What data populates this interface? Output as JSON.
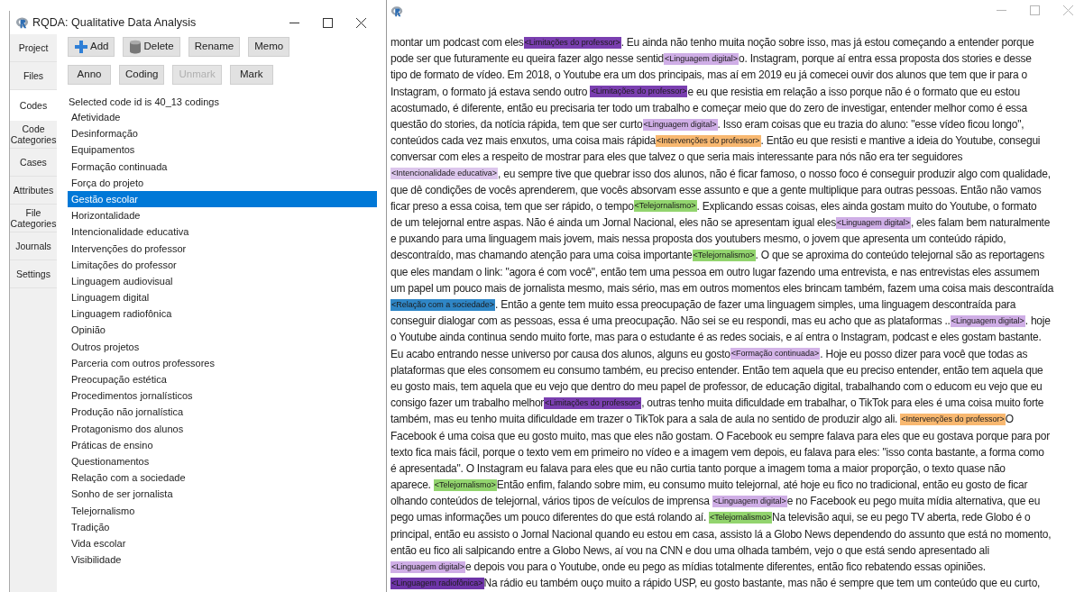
{
  "left_window": {
    "title": "RQDA: Qualitative Data Analysis",
    "sidebar_tabs": [
      {
        "label": "Project",
        "selected": false
      },
      {
        "label": "Files",
        "selected": false
      },
      {
        "label": "Codes",
        "selected": true
      },
      {
        "label": "Code Categories",
        "selected": false
      },
      {
        "label": "Cases",
        "selected": false
      },
      {
        "label": "Attributes",
        "selected": false
      },
      {
        "label": "File Categories",
        "selected": false
      },
      {
        "label": "Journals",
        "selected": false
      },
      {
        "label": "Settings",
        "selected": false
      }
    ],
    "button_rows": [
      [
        {
          "kind": "add",
          "label": "Add",
          "disabled": false
        },
        {
          "kind": "delete",
          "label": "Delete",
          "disabled": false
        },
        {
          "kind": "plain",
          "label": "Rename",
          "disabled": false
        },
        {
          "kind": "plain",
          "label": "Memo",
          "disabled": false
        }
      ],
      [
        {
          "kind": "plain",
          "label": "Anno",
          "disabled": false
        },
        {
          "kind": "plain",
          "label": "Coding",
          "disabled": false
        },
        {
          "kind": "plain",
          "label": "Unmark",
          "disabled": true
        },
        {
          "kind": "plain",
          "label": "Mark",
          "disabled": false
        }
      ]
    ],
    "status": "Selected code id is 40_13 codings",
    "codes": [
      {
        "label": "Afetividade",
        "selected": false
      },
      {
        "label": "Desinformação",
        "selected": false
      },
      {
        "label": "Equipamentos",
        "selected": false
      },
      {
        "label": "Formação continuada",
        "selected": false
      },
      {
        "label": "Força do projeto",
        "selected": false
      },
      {
        "label": "Gestão escolar",
        "selected": true
      },
      {
        "label": "Horizontalidade",
        "selected": false
      },
      {
        "label": "Intencionalidade educativa",
        "selected": false
      },
      {
        "label": "Intervenções do professor",
        "selected": false
      },
      {
        "label": "Limitações do professor",
        "selected": false
      },
      {
        "label": "Linguagem audiovisual",
        "selected": false
      },
      {
        "label": "Linguagem digital",
        "selected": false
      },
      {
        "label": "Linguagem radiofônica",
        "selected": false
      },
      {
        "label": "Opinião",
        "selected": false
      },
      {
        "label": "Outros projetos",
        "selected": false
      },
      {
        "label": "Parceria com outros professores",
        "selected": false
      },
      {
        "label": "Preocupação estética",
        "selected": false
      },
      {
        "label": "Procedimentos jornalísticos",
        "selected": false
      },
      {
        "label": "Produção não jornalística",
        "selected": false
      },
      {
        "label": "Protagonismo dos alunos",
        "selected": false
      },
      {
        "label": "Práticas de ensino",
        "selected": false
      },
      {
        "label": "Questionamentos",
        "selected": false
      },
      {
        "label": "Relação com a sociedade",
        "selected": false
      },
      {
        "label": "Sonho de ser jornalista",
        "selected": false
      },
      {
        "label": "Telejornalismo",
        "selected": false
      },
      {
        "label": "Tradição",
        "selected": false
      },
      {
        "label": "Vida escolar",
        "selected": false
      },
      {
        "label": "Visibilidade",
        "selected": false
      }
    ]
  },
  "right_window": {
    "lines": [
      {
        "segments": [
          {
            "kind": "text",
            "text": "montar um podcast com eles"
          },
          {
            "kind": "code",
            "text": "<Limitações do professor>",
            "color": "#7a3fb0"
          },
          {
            "kind": "text",
            "text": ". Eu ainda não tenho muita noção sobre isso, mas já estou começando a entender porque"
          }
        ]
      },
      {
        "segments": [
          {
            "kind": "text",
            "text": "pode ser que futuramente eu queira fazer algo nesse sentid"
          },
          {
            "kind": "code",
            "text": "<Linguagem digital>",
            "color": "#cfaee6"
          },
          {
            "kind": "text",
            "text": "o. Instagram, porque aí entra essa proposta dos stories e desse"
          }
        ]
      },
      {
        "segments": [
          {
            "kind": "text",
            "text": "tipo de formato de vídeo. Em 2018, o Youtube era um dos principais, mas aí em 2019 eu já comecei ouvir dos alunos que tem que ir para o"
          }
        ]
      },
      {
        "segments": [
          {
            "kind": "text",
            "text": "Instagram, o formato já estava sendo outro "
          },
          {
            "kind": "code",
            "text": "<Limitações do professor>",
            "color": "#7a3fb0"
          },
          {
            "kind": "text",
            "text": "e eu que resistia em relação a isso porque não é o formato que eu estou"
          }
        ]
      },
      {
        "segments": [
          {
            "kind": "text",
            "text": "acostumado, é diferente, então eu precisaria ter todo um trabalho e começar meio que do zero de investigar, entender melhor como é essa"
          }
        ]
      },
      {
        "segments": [
          {
            "kind": "text",
            "text": "questão do stories, da notícia rápida, tem que ser curto"
          },
          {
            "kind": "code",
            "text": "<Linguagem digital>",
            "color": "#cfaee6"
          },
          {
            "kind": "text",
            "text": ". Isso eram coisas que eu trazia do aluno: \"esse vídeo ficou longo\","
          }
        ]
      },
      {
        "segments": [
          {
            "kind": "text",
            "text": "conteúdos cada vez mais enxutos, uma coisa mais rápida"
          },
          {
            "kind": "code",
            "text": "<Intervenções do professor>",
            "color": "#f8b870"
          },
          {
            "kind": "text",
            "text": ". Então eu que resisti e mantive a ideia do Youtube, consegui"
          }
        ]
      },
      {
        "segments": [
          {
            "kind": "text",
            "text": "conversar com eles a respeito de mostrar para eles que talvez o que seria mais interessante para nós não era ter seguidores"
          }
        ]
      },
      {
        "segments": [
          {
            "kind": "code",
            "text": "<Intencionalidade educativa>",
            "color": "#dcc6ec"
          },
          {
            "kind": "text",
            "text": ", eu sempre tive que quebrar isso dos alunos, não é ficar famoso, o nosso foco é conseguir produzir algo com qualidade,"
          }
        ]
      },
      {
        "segments": [
          {
            "kind": "text",
            "text": "que dê condições de vocês aprenderem, que vocês absorvam esse assunto e que a gente multiplique para outras pessoas. Então não vamos"
          }
        ]
      },
      {
        "segments": [
          {
            "kind": "text",
            "text": "ficar preso a essa coisa, tem que ser rápido, o tempo"
          },
          {
            "kind": "code",
            "text": "<Telejornalismo>",
            "color": "#92d46e"
          },
          {
            "kind": "text",
            "text": ". Explicando essas coisas, eles ainda gostam muito do Youtube, o formato"
          }
        ]
      },
      {
        "segments": [
          {
            "kind": "text",
            "text": "de um telejornal entre aspas. Não é ainda um Jornal Nacional, eles não se apresentam igual eles"
          },
          {
            "kind": "code",
            "text": "<Linguagem digital>",
            "color": "#cfaee6"
          },
          {
            "kind": "text",
            "text": ", eles falam bem naturalmente"
          }
        ]
      },
      {
        "segments": [
          {
            "kind": "text",
            "text": "e puxando para uma linguagem mais jovem, mais nessa proposta dos youtubers mesmo, o jovem que apresenta um conteúdo rápido,"
          }
        ]
      },
      {
        "segments": [
          {
            "kind": "text",
            "text": "descontraído, mas chamando atenção para uma coisa importante"
          },
          {
            "kind": "code",
            "text": "<Telejornalismo>",
            "color": "#92d46e"
          },
          {
            "kind": "text",
            "text": ". O que se aproxima do conteúdo telejornal são as reportagens"
          }
        ]
      },
      {
        "segments": [
          {
            "kind": "text",
            "text": "que eles mandam o link: \"agora é com você\", então tem uma pessoa em outro lugar fazendo uma entrevista, e nas entrevistas eles assumem"
          }
        ]
      },
      {
        "segments": [
          {
            "kind": "text",
            "text": "um papel um pouco mais de jornalista mesmo, mais sério, mas em outros momentos eles brincam também, fazem uma coisa mais descontraída"
          }
        ]
      },
      {
        "segments": [
          {
            "kind": "code",
            "text": "<Relação com a sociedade>",
            "color": "#2f86c6"
          },
          {
            "kind": "text",
            "text": ". Então a gente tem muito essa preocupação de fazer uma linguagem simples, uma linguagem descontraída para"
          }
        ]
      },
      {
        "segments": [
          {
            "kind": "text",
            "text": "conseguir dialogar com as pessoas, essa é uma preocupação. Não sei se eu respondi, mas eu acho que as plataformas .."
          },
          {
            "kind": "code",
            "text": "<Linguagem digital>",
            "color": "#cfaee6"
          },
          {
            "kind": "text",
            "text": ". hoje"
          }
        ]
      },
      {
        "segments": [
          {
            "kind": "text",
            "text": "o Youtube ainda continua sendo muito forte, mas para o estudante é as redes sociais, e aí entra o Instagram, podcast e eles gostam bastante."
          }
        ]
      },
      {
        "segments": [
          {
            "kind": "text",
            "text": "Eu acabo entrando nesse universo por causa dos alunos, alguns eu gosto"
          },
          {
            "kind": "code",
            "text": "<Formação continuada>",
            "color": "#d4b4e8"
          },
          {
            "kind": "text",
            "text": ". Hoje eu posso dizer para você que todas as"
          }
        ]
      },
      {
        "segments": [
          {
            "kind": "text",
            "text": "plataformas que eles consomem eu consumo também, eu preciso entender. Então tem aquela que eu preciso entender, então tem aquela que"
          }
        ]
      },
      {
        "segments": [
          {
            "kind": "text",
            "text": "eu gosto mais, tem aquela que eu vejo que dentro do meu papel de professor, de educação digital, trabalhando com o educom eu vejo que eu"
          }
        ]
      },
      {
        "segments": [
          {
            "kind": "text",
            "text": "consigo fazer um trabalho melhor"
          },
          {
            "kind": "code",
            "text": "<Limitações do professor>",
            "color": "#7a3fb0"
          },
          {
            "kind": "text",
            "text": ", outras tenho muita dificuldade em trabalhar, o TikTok para eles é uma coisa muito forte"
          }
        ]
      },
      {
        "segments": [
          {
            "kind": "text",
            "text": "também, mas eu tenho muita dificuldade em trazer o TikTok para a sala de aula no sentido de produzir algo ali. "
          },
          {
            "kind": "code",
            "text": "<Intervenções do professor>",
            "color": "#f8b870"
          },
          {
            "kind": "text",
            "text": "O"
          }
        ]
      },
      {
        "segments": [
          {
            "kind": "text",
            "text": "Facebook é uma coisa que eu gosto muito, mas que eles não gostam. O Facebook eu sempre falava para eles que eu gostava porque para por"
          }
        ]
      },
      {
        "segments": [
          {
            "kind": "text",
            "text": "texto fica mais fácil, porque o texto vem em primeiro no vídeo e a imagem vem depois, eu falava para eles: \"isso conta bastante, a forma como"
          }
        ]
      },
      {
        "segments": [
          {
            "kind": "text",
            "text": "é apresentada\". O Instagram eu falava para eles que eu não curtia tanto porque a imagem toma a maior proporção, o texto quase não"
          }
        ]
      },
      {
        "segments": [
          {
            "kind": "text",
            "text": "aparece. "
          },
          {
            "kind": "code",
            "text": "<Telejornalismo>",
            "color": "#92d46e"
          },
          {
            "kind": "text",
            "text": "Então enfim, falando sobre mim, eu consumo muito telejornal, até hoje eu fico no tradicional, então eu gosto de ficar"
          }
        ]
      },
      {
        "segments": [
          {
            "kind": "text",
            "text": "olhando conteúdos de telejornal, vários tipos de veículos de imprensa "
          },
          {
            "kind": "code",
            "text": "<Linguagem digital>",
            "color": "#cfaee6"
          },
          {
            "kind": "text",
            "text": "e no Facebook eu pego muita mídia alternativa, que eu"
          }
        ]
      },
      {
        "segments": [
          {
            "kind": "text",
            "text": "pego umas informações um pouco diferentes do que está rolando aí. "
          },
          {
            "kind": "code",
            "text": "<Telejornalismo>",
            "color": "#92d46e"
          },
          {
            "kind": "text",
            "text": "Na televisão aqui, se eu pego TV aberta, rede Globo é o"
          }
        ]
      },
      {
        "segments": [
          {
            "kind": "text",
            "text": "principal, então eu assisto o Jornal Nacional quando eu estou em casa, assisto lá a Globo News dependendo do assunto que está no momento,"
          }
        ]
      },
      {
        "segments": [
          {
            "kind": "text",
            "text": "então eu fico ali salpicando entre a Globo News, aí vou na CNN e dou uma olhada também, vejo o que está sendo apresentado ali"
          }
        ]
      },
      {
        "segments": [
          {
            "kind": "code",
            "text": "<Linguagem digital>",
            "color": "#cfaee6"
          },
          {
            "kind": "text",
            "text": "e depois vou para o Youtube, onde eu pego as mídias totalmente diferentes, então fico rebatendo essas opiniões."
          }
        ]
      },
      {
        "segments": [
          {
            "kind": "code",
            "text": "<Linguagem radiofônica>",
            "color": "#6e35a8"
          },
          {
            "kind": "text",
            "text": "Na rádio eu também ouço muito a rápido USP, eu gosto bastante, mas não é sempre que tem um conteúdo que eu curto,"
          }
        ]
      }
    ]
  }
}
